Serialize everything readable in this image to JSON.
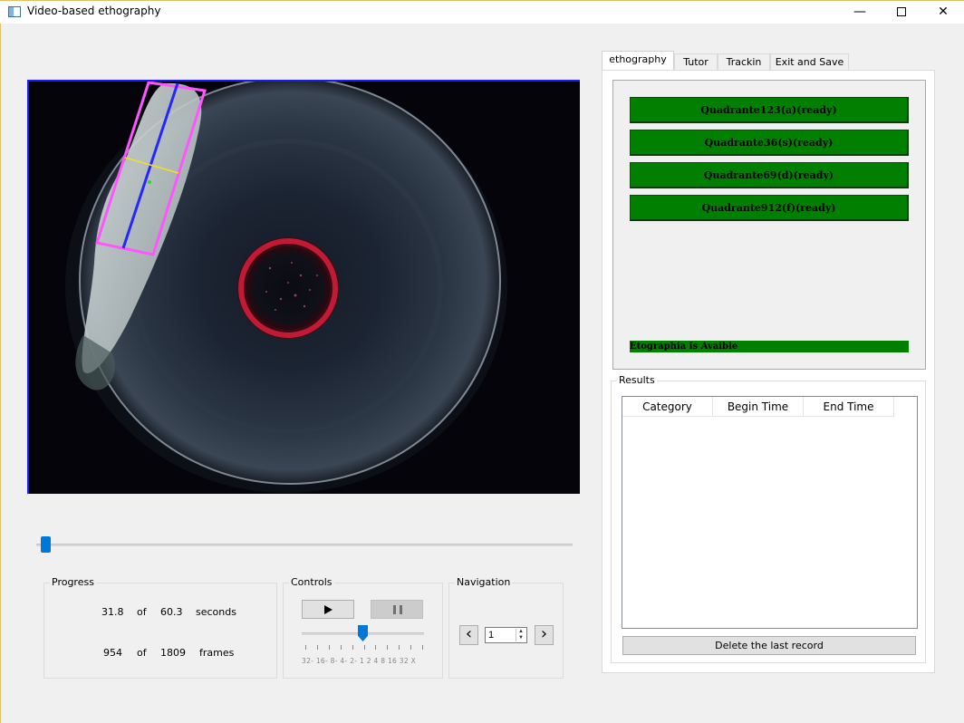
{
  "window": {
    "title": "Video-based ethography"
  },
  "icons": {
    "app": "app-icon",
    "minimize": "minimize-icon",
    "maximize": "maximize-icon",
    "close": "close-icon",
    "play": "play-icon",
    "pause": "pause-icon",
    "prev": "chevron-left-icon",
    "next": "chevron-right-icon"
  },
  "timeline": {
    "position_fraction": 0.008
  },
  "progress": {
    "title": "Progress",
    "seconds_current": "31.8",
    "seconds_of": "of",
    "seconds_total": "60.3",
    "seconds_unit": "seconds",
    "frames_current": "954",
    "frames_of": "of",
    "frames_total": "1809",
    "frames_unit": "frames"
  },
  "controls": {
    "title": "Controls",
    "speed_labels": "32- 16- 8- 4- 2- 1 2 4 8 16 32 X",
    "speed_value": "1"
  },
  "navigation": {
    "title": "Navigation",
    "step_value": "1"
  },
  "tabs": [
    {
      "label": "ethography",
      "active": true
    },
    {
      "label": "Tutor",
      "active": false
    },
    {
      "label": "Trackin",
      "active": false
    },
    {
      "label": "Exit and Save",
      "active": false
    }
  ],
  "ethography": {
    "buttons": [
      "Quadrante123(a)(ready)",
      "Quadrante36(s)(ready)",
      "Quadrante69(d)(ready)",
      "Quadrante912(f)(ready)"
    ],
    "status": "Etographia is Avaible",
    "accent_color": "#007f00"
  },
  "results": {
    "title": "Results",
    "columns": [
      "Category",
      "Begin Time",
      "End Time"
    ],
    "rows": [],
    "delete_label": "Delete the last record"
  }
}
